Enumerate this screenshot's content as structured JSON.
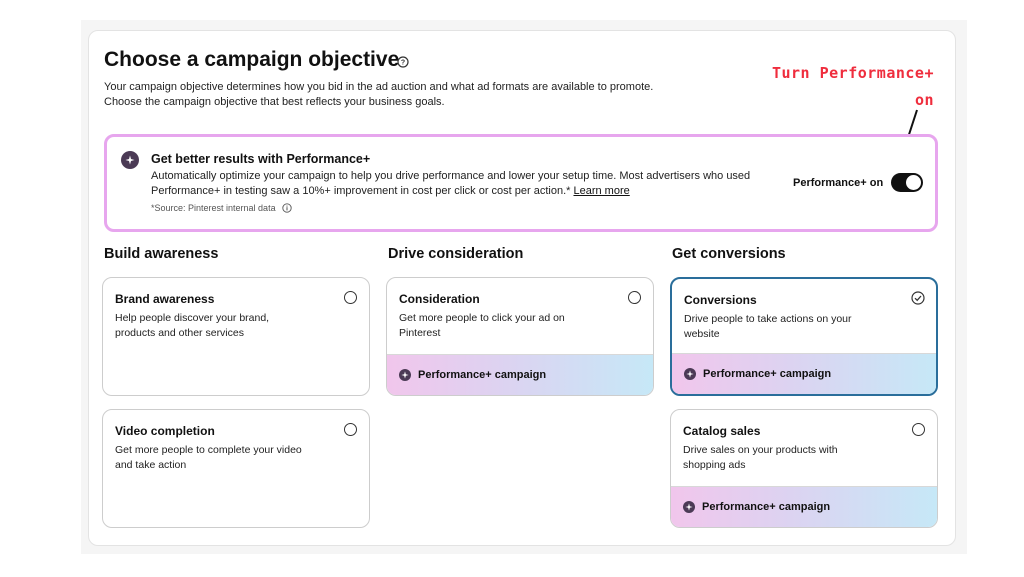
{
  "header": {
    "title": "Choose a campaign objective",
    "subtitle_line1": "Your campaign objective determines how you bid in the ad auction and what ad formats are available to promote.",
    "subtitle_line2": "Choose the campaign objective that best reflects your business goals."
  },
  "annotation": {
    "line1": "Turn Performance+",
    "line2": "on",
    "color": "#ef2d3d"
  },
  "promo": {
    "title": "Get better results with Performance+",
    "description": "Automatically optimize your campaign to help you drive performance and lower your setup time. Most advertisers who used Performance+ in testing saw a 10%+ improvement in cost per click or cost per action.*",
    "learn_more": "Learn more",
    "source": "*Source: Pinterest internal data",
    "toggle_label": "Performance+ on",
    "toggle_on": true,
    "border_color": "#e7a6ee"
  },
  "columns": [
    {
      "heading": "Build awareness",
      "cards": [
        {
          "title": "Brand awareness",
          "description": "Help people discover your brand, products and other services",
          "selected": false
        },
        {
          "title": "Video completion",
          "description": "Get more people to complete your video and take action",
          "selected": false
        }
      ]
    },
    {
      "heading": "Drive consideration",
      "cards": [
        {
          "title": "Consideration",
          "description": "Get more people to click your ad on Pinterest",
          "selected": false,
          "footer": "Performance+ campaign"
        }
      ]
    },
    {
      "heading": "Get conversions",
      "cards": [
        {
          "title": "Conversions",
          "description": "Drive people to take actions on your website",
          "selected": true,
          "footer": "Performance+ campaign"
        },
        {
          "title": "Catalog sales",
          "description": "Drive sales on your products with shopping ads",
          "selected": false,
          "footer": "Performance+ campaign"
        }
      ]
    }
  ]
}
